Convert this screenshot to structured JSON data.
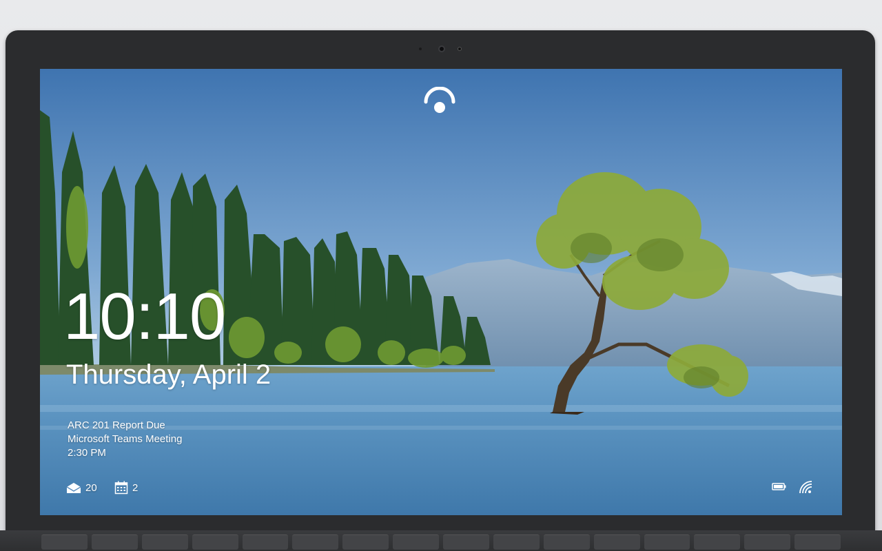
{
  "lock_screen": {
    "time": "10:10",
    "date": "Thursday, April 2",
    "event": {
      "title": "ARC 201 Report Due",
      "location": "Microsoft Teams Meeting",
      "time": "2:30 PM"
    },
    "notifications": {
      "mail_count": "20",
      "calendar_count": "2"
    },
    "icons": {
      "face_sign_in": "windows-hello-face-icon",
      "mail": "mail-icon",
      "calendar": "calendar-icon",
      "battery": "battery-icon",
      "network": "wifi-icon"
    }
  },
  "wallpaper": {
    "description_colors": {
      "sky_top": "#4a7fb8",
      "sky_bottom": "#a9c9e2",
      "lake": "#5d93c0",
      "trees": "#2f5a2a"
    }
  }
}
